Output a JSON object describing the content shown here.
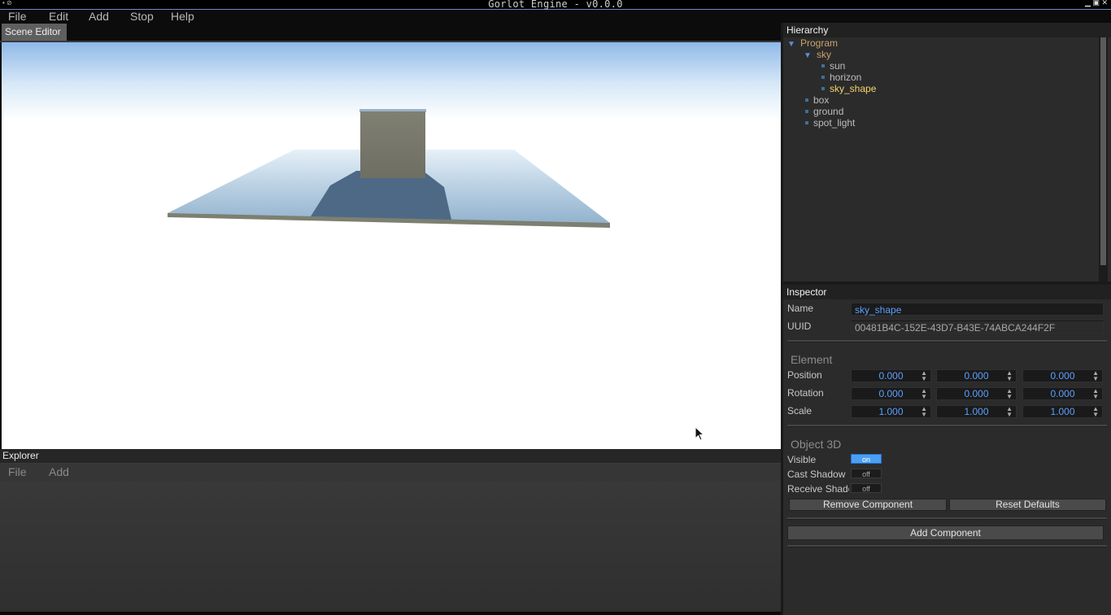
{
  "window": {
    "title": "Gorlot Engine - v0.0.0"
  },
  "menubar": {
    "items": [
      "File",
      "Edit",
      "Add",
      "Stop",
      "Help"
    ]
  },
  "scene_editor": {
    "tab_label": "Scene Editor"
  },
  "explorer": {
    "title": "Explorer",
    "menu": [
      "File",
      "Add"
    ]
  },
  "hierarchy": {
    "title": "Hierarchy",
    "tree": [
      {
        "label": "Program",
        "expanded": true
      },
      {
        "label": "sky",
        "expanded": true
      },
      {
        "label": "sun"
      },
      {
        "label": "horizon"
      },
      {
        "label": "sky_shape",
        "selected": true
      },
      {
        "label": "box"
      },
      {
        "label": "ground"
      },
      {
        "label": "spot_light"
      }
    ]
  },
  "inspector": {
    "title": "Inspector",
    "name_label": "Name",
    "name_value": "sky_shape",
    "uuid_label": "UUID",
    "uuid_value": "00481B4C-152E-43D7-B43E-74ABCA244F2F",
    "element": {
      "title": "Element",
      "position": {
        "label": "Position",
        "x": "0.000",
        "y": "0.000",
        "z": "0.000"
      },
      "rotation": {
        "label": "Rotation",
        "x": "0.000",
        "y": "0.000",
        "z": "0.000"
      },
      "scale": {
        "label": "Scale",
        "x": "1.000",
        "y": "1.000",
        "z": "1.000"
      }
    },
    "object3d": {
      "title": "Object 3D",
      "visible": {
        "label": "Visible",
        "value": "on"
      },
      "cast_shadow": {
        "label": "Cast Shadow",
        "value": "off"
      },
      "receive_shadow": {
        "label": "Receive Shadow",
        "value": "off"
      }
    },
    "remove_component": "Remove Component",
    "reset_defaults": "Reset Defaults",
    "add_component": "Add Component"
  },
  "colors": {
    "accent_blue": "#5aa0ff",
    "selected_tree_item": "#f5d56a",
    "tree_parent": "#c9a36a",
    "toggle_on": "#4a9ff5"
  }
}
